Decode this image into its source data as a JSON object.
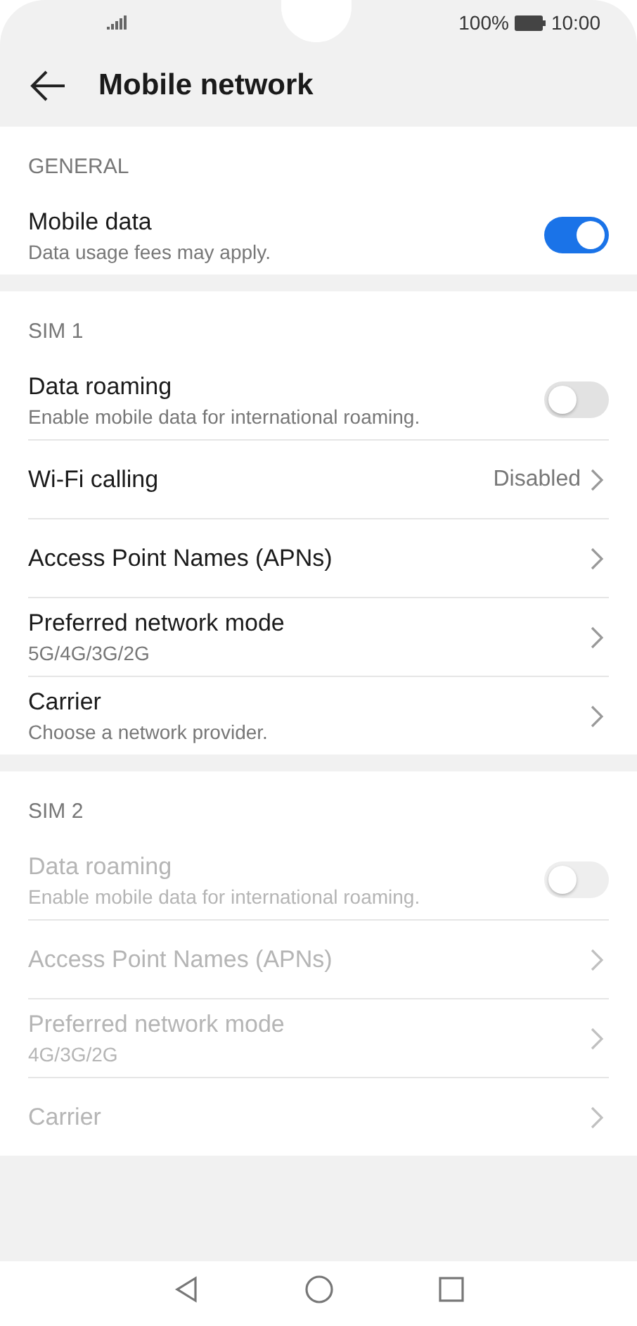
{
  "status_bar": {
    "battery": "100%",
    "time": "10:00"
  },
  "header": {
    "title": "Mobile network"
  },
  "sections": [
    {
      "title": "GENERAL",
      "rows": [
        {
          "kind": "toggle",
          "title": "Mobile data",
          "subtitle": "Data usage fees may apply.",
          "on": true,
          "disabled": false
        }
      ]
    },
    {
      "title": "SIM 1",
      "rows": [
        {
          "kind": "toggle",
          "title": "Data roaming",
          "subtitle": "Enable mobile data for international roaming.",
          "on": false,
          "disabled": false
        },
        {
          "kind": "link",
          "title": "Wi-Fi calling",
          "value": "Disabled",
          "disabled": false
        },
        {
          "kind": "link",
          "title": "Access Point Names (APNs)",
          "disabled": false
        },
        {
          "kind": "link",
          "title": "Preferred network mode",
          "subtitle": "5G/4G/3G/2G",
          "disabled": false
        },
        {
          "kind": "link",
          "title": "Carrier",
          "subtitle": "Choose a network provider.",
          "disabled": false
        }
      ]
    },
    {
      "title": "SIM 2",
      "rows": [
        {
          "kind": "toggle",
          "title": "Data roaming",
          "subtitle": "Enable mobile data for international roaming.",
          "on": false,
          "disabled": true
        },
        {
          "kind": "link",
          "title": "Access Point Names (APNs)",
          "disabled": true
        },
        {
          "kind": "link",
          "title": "Preferred network mode",
          "subtitle": "4G/3G/2G",
          "disabled": true
        },
        {
          "kind": "link",
          "title": "Carrier",
          "disabled": true
        }
      ]
    }
  ]
}
